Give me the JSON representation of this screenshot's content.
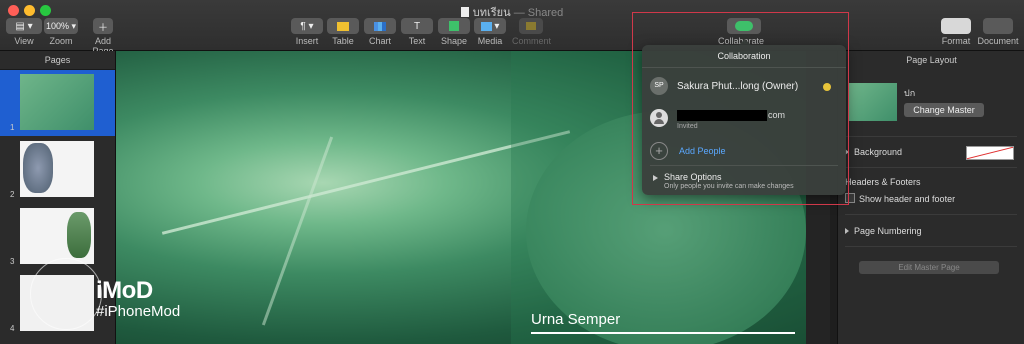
{
  "window": {
    "title": "บทเรียน",
    "subtitle": "— Shared"
  },
  "toolbar": {
    "view_label": "View",
    "zoom_label": "Zoom",
    "zoom_value": "100%",
    "add_page_label": "Add Page",
    "insert_label": "Insert",
    "table_label": "Table",
    "chart_label": "Chart",
    "text_label": "Text",
    "shape_label": "Shape",
    "media_label": "Media",
    "comment_label": "Comment",
    "collaborate_label": "Collaborate",
    "format_label": "Format",
    "document_label": "Document"
  },
  "sidebar": {
    "header": "Pages",
    "pages": [
      {
        "num": "1"
      },
      {
        "num": "2"
      },
      {
        "num": "3"
      },
      {
        "num": "4"
      }
    ]
  },
  "slide": {
    "caption": "Urna Semper"
  },
  "watermark": {
    "brand": "iMoD",
    "handle": "#iPhoneMod"
  },
  "inspector": {
    "title": "Page Layout",
    "master_name": "ปก",
    "change_master_label": "Change Master",
    "background_label": "Background",
    "headers_footers_label": "Headers & Footers",
    "show_header_footer_label": "Show header and footer",
    "page_numbering_label": "Page Numbering",
    "edit_master_label": "Edit Master Page"
  },
  "collaboration": {
    "title": "Collaboration",
    "owner_initials": "SP",
    "owner_name": "Sakura Phut...long (Owner)",
    "invitee_email_suffix": "com",
    "invitee_status": "Invited",
    "add_people_label": "Add People",
    "share_options_label": "Share Options",
    "share_options_desc": "Only people you invite can make changes",
    "owner_status_color": "#e8c43a"
  },
  "colors": {
    "selection": "#1f5fd1",
    "link": "#5aa8ff",
    "highlight_frame": "#d0384a"
  }
}
